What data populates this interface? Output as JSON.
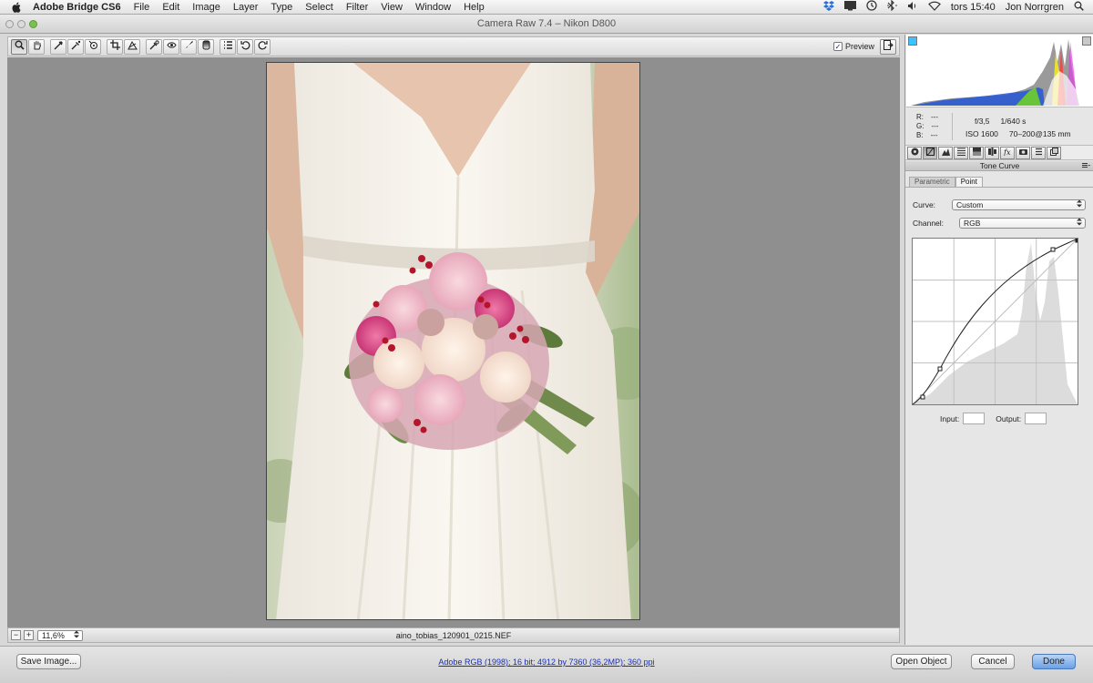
{
  "menubar": {
    "app_name": "Adobe Bridge CS6",
    "menus": [
      "File",
      "Edit",
      "Image",
      "Layer",
      "Type",
      "Select",
      "Filter",
      "View",
      "Window",
      "Help"
    ],
    "clock": "tors 15:40",
    "user": "Jon Norrgren"
  },
  "window": {
    "title": "Camera Raw 7.4  –  Nikon D800"
  },
  "toolbar": {
    "tools": [
      {
        "name": "zoom-tool",
        "glyph": "🔍"
      },
      {
        "name": "hand-tool",
        "glyph": "✋"
      },
      {
        "name": "white-balance-tool",
        "glyph": "⁄"
      },
      {
        "name": "color-sampler-tool",
        "glyph": "✎"
      },
      {
        "name": "targeted-adjustment-tool",
        "glyph": "◎"
      },
      {
        "name": "crop-tool",
        "glyph": "⌗"
      },
      {
        "name": "straighten-tool",
        "glyph": "△"
      },
      {
        "name": "spot-removal-tool",
        "glyph": "✐"
      },
      {
        "name": "red-eye-tool",
        "glyph": "◉"
      },
      {
        "name": "adjustment-brush-tool",
        "glyph": "✒"
      },
      {
        "name": "graduated-filter-tool",
        "glyph": "▯"
      },
      {
        "name": "preferences-tool",
        "glyph": "☰"
      },
      {
        "name": "rotate-ccw-tool",
        "glyph": "↺"
      },
      {
        "name": "rotate-cw-tool",
        "glyph": "↻"
      }
    ],
    "preview_label": "Preview",
    "preview_checked": "✓"
  },
  "status": {
    "zoom_minus": "−",
    "zoom_plus": "+",
    "zoom_value": "11,6%",
    "filename": "aino_tobias_120901_0215.NEF"
  },
  "bottom": {
    "save_label": "Save Image...",
    "workflow_link": "Adobe RGB (1998); 16 bit; 4912 by 7360 (36,2MP); 360 ppi",
    "open_label": "Open Object",
    "cancel_label": "Cancel",
    "done_label": "Done"
  },
  "info": {
    "r_label": "R:",
    "r_value": "---",
    "g_label": "G:",
    "g_value": "---",
    "b_label": "B:",
    "b_value": "---",
    "aperture": "f/3,5",
    "shutter": "1/640 s",
    "iso": "ISO 1600",
    "lens": "70–200@135 mm"
  },
  "panel": {
    "title": "Tone Curve",
    "subtabs": [
      "Parametric",
      "Point"
    ],
    "active_subtab": "Point",
    "curve_label": "Curve:",
    "curve_value": "Custom",
    "channel_label": "Channel:",
    "channel_value": "RGB",
    "input_label": "Input:",
    "output_label": "Output:"
  },
  "colors": {
    "accent": "#6aa1e8",
    "canvas_bg": "#8f8f8f",
    "link": "#1b2fb0"
  }
}
